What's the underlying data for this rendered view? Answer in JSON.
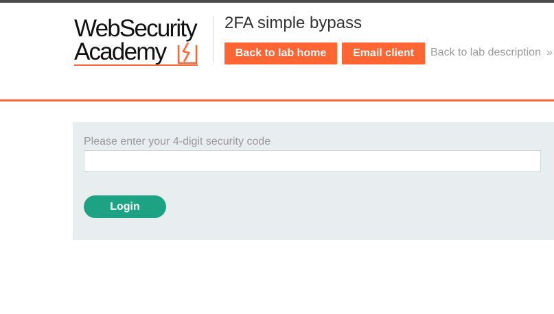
{
  "logo": {
    "line1": "WebSecurity",
    "line2": "Academy",
    "mark_icon": "lightning-icon",
    "accent_color": "#ff6633"
  },
  "header": {
    "title": "2FA simple bypass",
    "back_to_lab_home": "Back to lab home",
    "email_client": "Email client",
    "back_to_lab_description": "Back to lab description",
    "chevron": "»"
  },
  "form": {
    "label": "Please enter your 4-digit security code",
    "input_value": "",
    "login_label": "Login",
    "login_color": "#1da384"
  }
}
